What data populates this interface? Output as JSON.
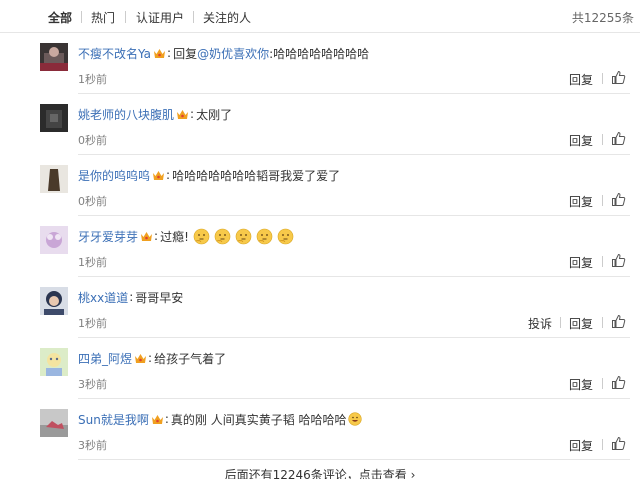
{
  "tabs": [
    {
      "label": "全部",
      "active": true
    },
    {
      "label": "热门",
      "active": false
    },
    {
      "label": "认证用户",
      "active": false
    },
    {
      "label": "关注的人",
      "active": false
    }
  ],
  "total_label": "共12255条",
  "vip_icon": "crown-vip-icon",
  "comments": [
    {
      "user": "不瘦不改名Ya",
      "prefix": "回复",
      "mention": "@奶优喜欢你",
      "text": ":哈哈哈哈哈哈哈哈",
      "time": "1秒前",
      "reply": "回复"
    },
    {
      "user": "姚老师的八块腹肌",
      "text": "太刚了",
      "time": "0秒前",
      "reply": "回复"
    },
    {
      "user": "是你的呜呜呜",
      "text": "哈哈哈哈哈哈哈韬哥我爱了爱了",
      "time": "0秒前",
      "reply": "回复"
    },
    {
      "user": "牙牙爱芽芽",
      "text": "过瘾!",
      "time": "1秒前",
      "reply": "回复",
      "emojis": [
        "thinking-emoji",
        "thinking-emoji",
        "thinking-emoji",
        "thinking-emoji",
        "thinking-emoji"
      ]
    },
    {
      "user": "桃xx道道",
      "text": "哥哥早安",
      "time": "1秒前",
      "report": "投诉",
      "reply": "回复"
    },
    {
      "user": "四弟_阿煜",
      "text": "给孩子气着了",
      "time": "3秒前",
      "reply": "回复"
    },
    {
      "user": "Sun就是我啊",
      "text": "真的刚 人间真实黄子韬 哈哈哈哈",
      "time": "3秒前",
      "reply": "回复",
      "emojis": [
        "grin-emoji"
      ]
    }
  ],
  "more_label": "后面还有12246条评论，点击查看 ›",
  "colors": {
    "link": "#3b6fb6",
    "muted": "#808080",
    "divider": "#e6e6e6",
    "vip": "#f0a020"
  }
}
